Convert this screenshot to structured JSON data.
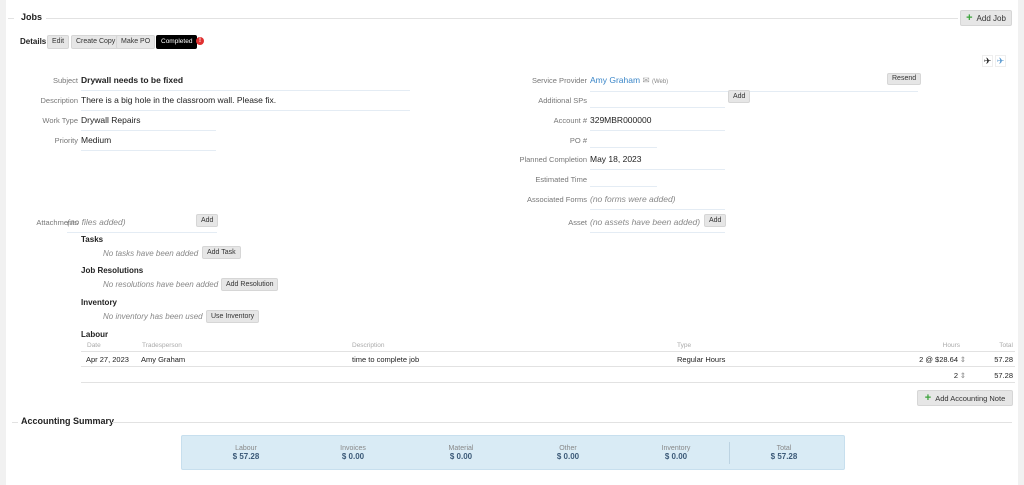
{
  "header": {
    "title": "Jobs",
    "add_job": "Add Job"
  },
  "details": {
    "title": "Details",
    "edit": "Edit",
    "create_copy": "Create Copy",
    "make_po": "Make PO",
    "status": "Completed",
    "status_color": "#000000"
  },
  "left_fields": [
    {
      "label": "Subject",
      "value": "Drywall needs to be fixed"
    },
    {
      "label": "Description",
      "value": "There is a big hole in the classroom wall. Please fix."
    },
    {
      "label": "Work Type",
      "value": "Drywall Repairs"
    },
    {
      "label": "Priority",
      "value": "Medium"
    }
  ],
  "right_fields": {
    "service_provider": {
      "label": "Service Provider",
      "value": "Amy Graham",
      "via": "(Web)",
      "resend": "Resend"
    },
    "additional_sps": {
      "label": "Additional SPs",
      "add": "Add"
    },
    "account": {
      "label": "Account #",
      "value": "329MBR000000"
    },
    "po": {
      "label": "PO #",
      "value": ""
    },
    "planned": {
      "label": "Planned Completion",
      "value": "May 18, 2023"
    },
    "estimated": {
      "label": "Estimated Time",
      "value": ""
    },
    "forms": {
      "label": "Associated Forms",
      "value": "(no forms were added)"
    },
    "asset": {
      "label": "Asset",
      "value": "(no assets have been added)",
      "add": "Add"
    }
  },
  "attachments": {
    "label": "Attachments",
    "value": "(no files added)",
    "add": "Add"
  },
  "tasks": {
    "title": "Tasks",
    "empty": "No tasks have been added",
    "button": "Add Task"
  },
  "resolutions": {
    "title": "Job Resolutions",
    "empty": "No resolutions have been added",
    "button": "Add Resolution"
  },
  "inventory": {
    "title": "Inventory",
    "empty": "No inventory has been used",
    "button": "Use Inventory"
  },
  "labour": {
    "title": "Labour",
    "columns": [
      "Date",
      "Tradesperson",
      "Description",
      "Type",
      "Hours",
      "Total"
    ],
    "rows": [
      {
        "date": "Apr 27, 2023",
        "tradesperson": "Amy Graham",
        "description": "time to complete job",
        "type": "Regular Hours",
        "hours": "2 @ $28.64",
        "total": "57.28"
      }
    ],
    "total_hours": "2",
    "total": "57.28"
  },
  "add_note": "Add Accounting Note",
  "summary": {
    "title": "Accounting Summary",
    "items": [
      {
        "label": "Labour",
        "value": "$ 57.28"
      },
      {
        "label": "Invoices",
        "value": "$ 0.00"
      },
      {
        "label": "Material",
        "value": "$ 0.00"
      },
      {
        "label": "Other",
        "value": "$ 0.00"
      },
      {
        "label": "Inventory",
        "value": "$ 0.00"
      },
      {
        "label": "Total",
        "value": "$ 57.28"
      }
    ]
  }
}
